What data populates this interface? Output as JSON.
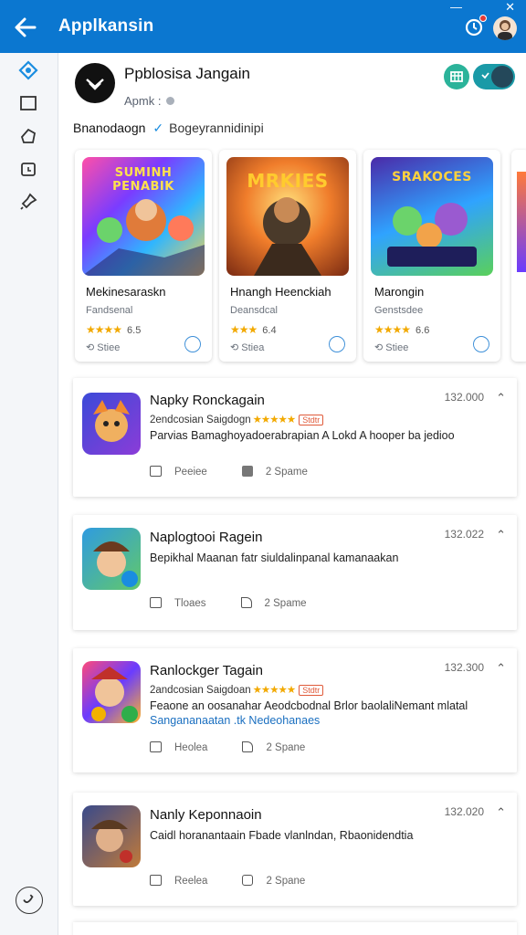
{
  "topbar": {
    "title": "Applkansin",
    "minimize_glyph": "—",
    "close_glyph": "✕"
  },
  "app": {
    "name": "Ppblosisa Jangain",
    "meta": "Apmk :",
    "section_title": "Bnanodaogn",
    "section_sub": "Bogeyrannidinipi"
  },
  "featured": [
    {
      "art_title": "SUMINH PENABIK",
      "name": "Mekinesaraskn",
      "sub": "Fandsenal",
      "stars": "★★★★",
      "rating": "6.5",
      "downloads": "Stiee",
      "icon": "download-circle-icon"
    },
    {
      "art_title": "MRKIES",
      "name": "Hnangh Heenckiah",
      "sub": "Deansdcal",
      "stars": "★★★",
      "rating": "6.4",
      "downloads": "Stiea",
      "icon": "download-circle-icon"
    },
    {
      "art_title": "SRAKOCES",
      "name": "Marongin",
      "sub": "Genstsdee",
      "stars": "★★★★",
      "rating": "6.6",
      "downloads": "Stiee",
      "icon": "download-circle-icon"
    }
  ],
  "list": [
    {
      "title": "Napky Ronckagain",
      "number": "132.000",
      "meta": "2endcosian Saigdogn",
      "stars": "★★★★★",
      "badge": "Stdtr",
      "desc": "Parvias Bamaghoyadoerabrapian A Lokd A hooper ba jedioo",
      "desc2": "",
      "likes": "Peeiee",
      "shares": "2 Spame"
    },
    {
      "title": "Naplogtooi Ragein",
      "number": "132.022",
      "meta": "",
      "stars": "",
      "badge": "",
      "desc": "Bepikhal Maanan fatr siuldalinpanal kamanaakan",
      "desc2": "",
      "likes": "Tloaes",
      "shares": "2 Spame"
    },
    {
      "title": "Ranlockger Tagain",
      "number": "132.300",
      "meta": "2andcosian Saigdoan",
      "stars": "★★★★★",
      "badge": "Stdtr",
      "desc": "Feaone an oosanahar Aeodcbodnal Brlor baolaliNemant mlatal",
      "desc2": "Sangananaatan .tk Nedeohanaes",
      "likes": "Heolea",
      "shares": "2 Spane"
    },
    {
      "title": "Nanly Keponnaoin",
      "number": "132.020",
      "meta": "",
      "stars": "",
      "badge": "",
      "desc": "Caidl horanantaain Fbade vlanlndan, Rbaonidendtia",
      "desc2": "",
      "likes": "Reelea",
      "shares": "2 Spane"
    }
  ]
}
